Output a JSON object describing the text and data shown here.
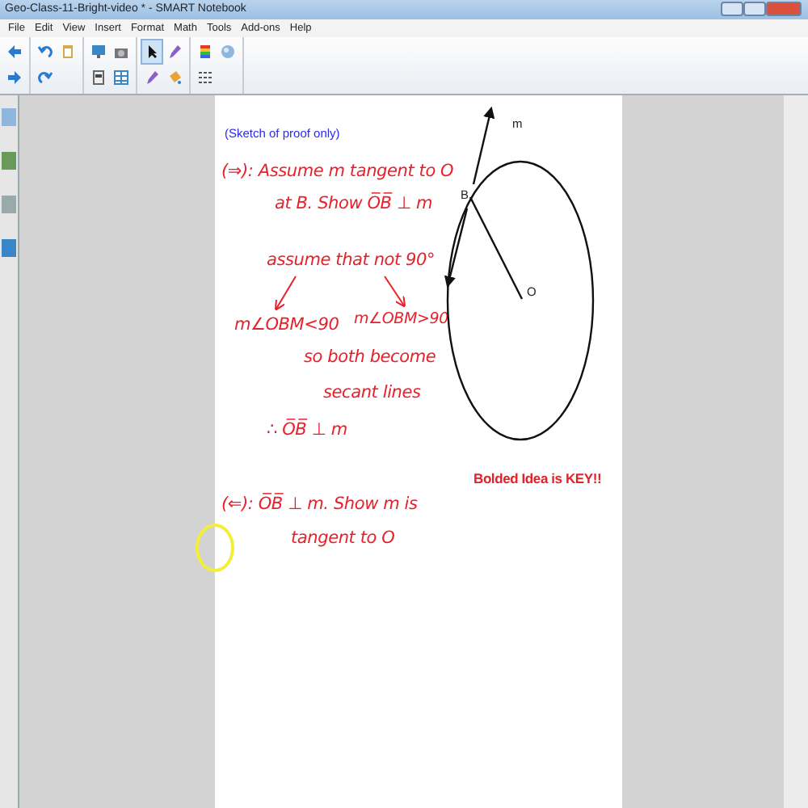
{
  "window": {
    "title": "Geo-Class-11-Bright-video * - SMART Notebook"
  },
  "menu": [
    "File",
    "Edit",
    "View",
    "Insert",
    "Format",
    "Math",
    "Tools",
    "Add-ons",
    "Help"
  ],
  "toolbar": [
    {
      "kind": "back",
      "selected": false
    },
    {
      "kind": "forward",
      "selected": false
    },
    {
      "kind": "undo",
      "selected": false
    },
    {
      "kind": "redo",
      "selected": false
    },
    {
      "kind": "paste",
      "selected": false
    },
    {
      "kind": "screen",
      "selected": false
    },
    {
      "kind": "doc",
      "selected": false
    },
    {
      "kind": "capture",
      "selected": false
    },
    {
      "kind": "table",
      "selected": false
    },
    {
      "kind": "select",
      "selected": true
    },
    {
      "kind": "pen",
      "selected": false
    },
    {
      "kind": "pen",
      "selected": false
    },
    {
      "kind": "fill",
      "selected": false
    },
    {
      "kind": "color",
      "selected": false
    },
    {
      "kind": "lines",
      "selected": false
    },
    {
      "kind": "ball",
      "selected": false
    }
  ],
  "page": {
    "notes": [
      {
        "text": "(Sketch of proof only)",
        "kind": "typed",
        "color": "#2a2af0"
      },
      {
        "text": "(⇒): Assume m tangent to O",
        "kind": "hand",
        "color": "#e8202a"
      },
      {
        "text": "at B. Show O̅B̅ ⊥ m",
        "kind": "hand",
        "color": "#e8202a"
      },
      {
        "text": "assume that not 90°",
        "kind": "hand",
        "color": "#e8202a"
      },
      {
        "text": "m∠OBM<90",
        "kind": "hand",
        "color": "#e8202a"
      },
      {
        "text": "m∠OBM>90",
        "kind": "hand",
        "color": "#e8202a"
      },
      {
        "text": "so both become",
        "kind": "hand",
        "color": "#e8202a"
      },
      {
        "text": "secant lines",
        "kind": "hand",
        "color": "#e8202a"
      },
      {
        "text": "∴ O̅B̅ ⊥ m",
        "kind": "hand",
        "color": "#e8202a"
      },
      {
        "text": "(⇐): O̅B̅ ⊥ m. Show m is",
        "kind": "hand",
        "color": "#e8202a"
      },
      {
        "text": "tangent to O",
        "kind": "hand",
        "color": "#e8202a"
      },
      {
        "text": "Bolded Idea is KEY!!",
        "kind": "bold",
        "color": "#e8202a"
      }
    ],
    "diagram_labels": [
      "m",
      "B",
      "O"
    ]
  }
}
